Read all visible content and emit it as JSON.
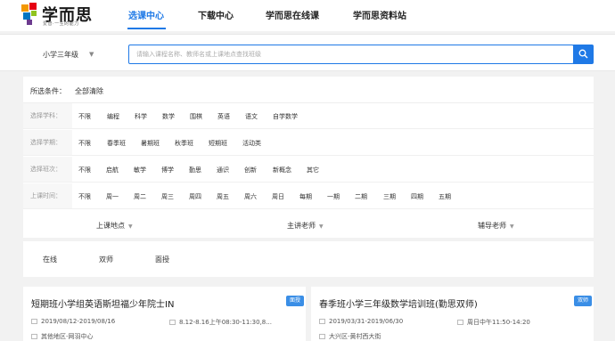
{
  "header": {
    "logo_text": "学而思",
    "logo_slogan": "爱智·一生的能力",
    "nav": [
      "选课中心",
      "下载中心",
      "学而思在线课",
      "学而思资料站"
    ]
  },
  "search": {
    "grade": "小学三年级",
    "placeholder": "请输入课程名称、教师名或上课地点查找班级"
  },
  "filters": {
    "selected_label": "所选条件：",
    "clear_all": "全部清除",
    "rows": [
      {
        "label": "选择学科：",
        "options": [
          "不限",
          "编程",
          "科学",
          "数学",
          "围棋",
          "英语",
          "语文",
          "自学数学"
        ]
      },
      {
        "label": "选择学期：",
        "options": [
          "不限",
          "春季班",
          "暑期班",
          "秋季班",
          "短期班",
          "活动类"
        ]
      },
      {
        "label": "选择班次：",
        "options": [
          "不限",
          "启航",
          "敏学",
          "博学",
          "勤思",
          "通识",
          "创新",
          "新概念",
          "其它"
        ]
      },
      {
        "label": "上课时间：",
        "options": [
          "不限",
          "周一",
          "周二",
          "周三",
          "周四",
          "周五",
          "周六",
          "周日",
          "每期",
          "一期",
          "二期",
          "三期",
          "四期",
          "五期"
        ]
      }
    ],
    "dropdowns": [
      "上课地点",
      "主讲老师",
      "辅导老师"
    ]
  },
  "modes": [
    "在线",
    "双师",
    "面授"
  ],
  "cards": [
    {
      "title": "短期班小学组英语斯坦福少年院士IN",
      "badge": "面授",
      "date": "2019/08/12-2019/08/16",
      "time": "8.12-8.16上午08:30-11:30,8...",
      "location": "其他地区-网羽中心"
    },
    {
      "title": "春季班小学三年级数学培训班(勤思双师)",
      "badge": "双师",
      "date": "2019/03/31-2019/06/30",
      "time": "周日中午11:50-14:20",
      "location": "大兴区-黄村西大街"
    }
  ],
  "colors": {
    "accent": "#1f79e6"
  }
}
